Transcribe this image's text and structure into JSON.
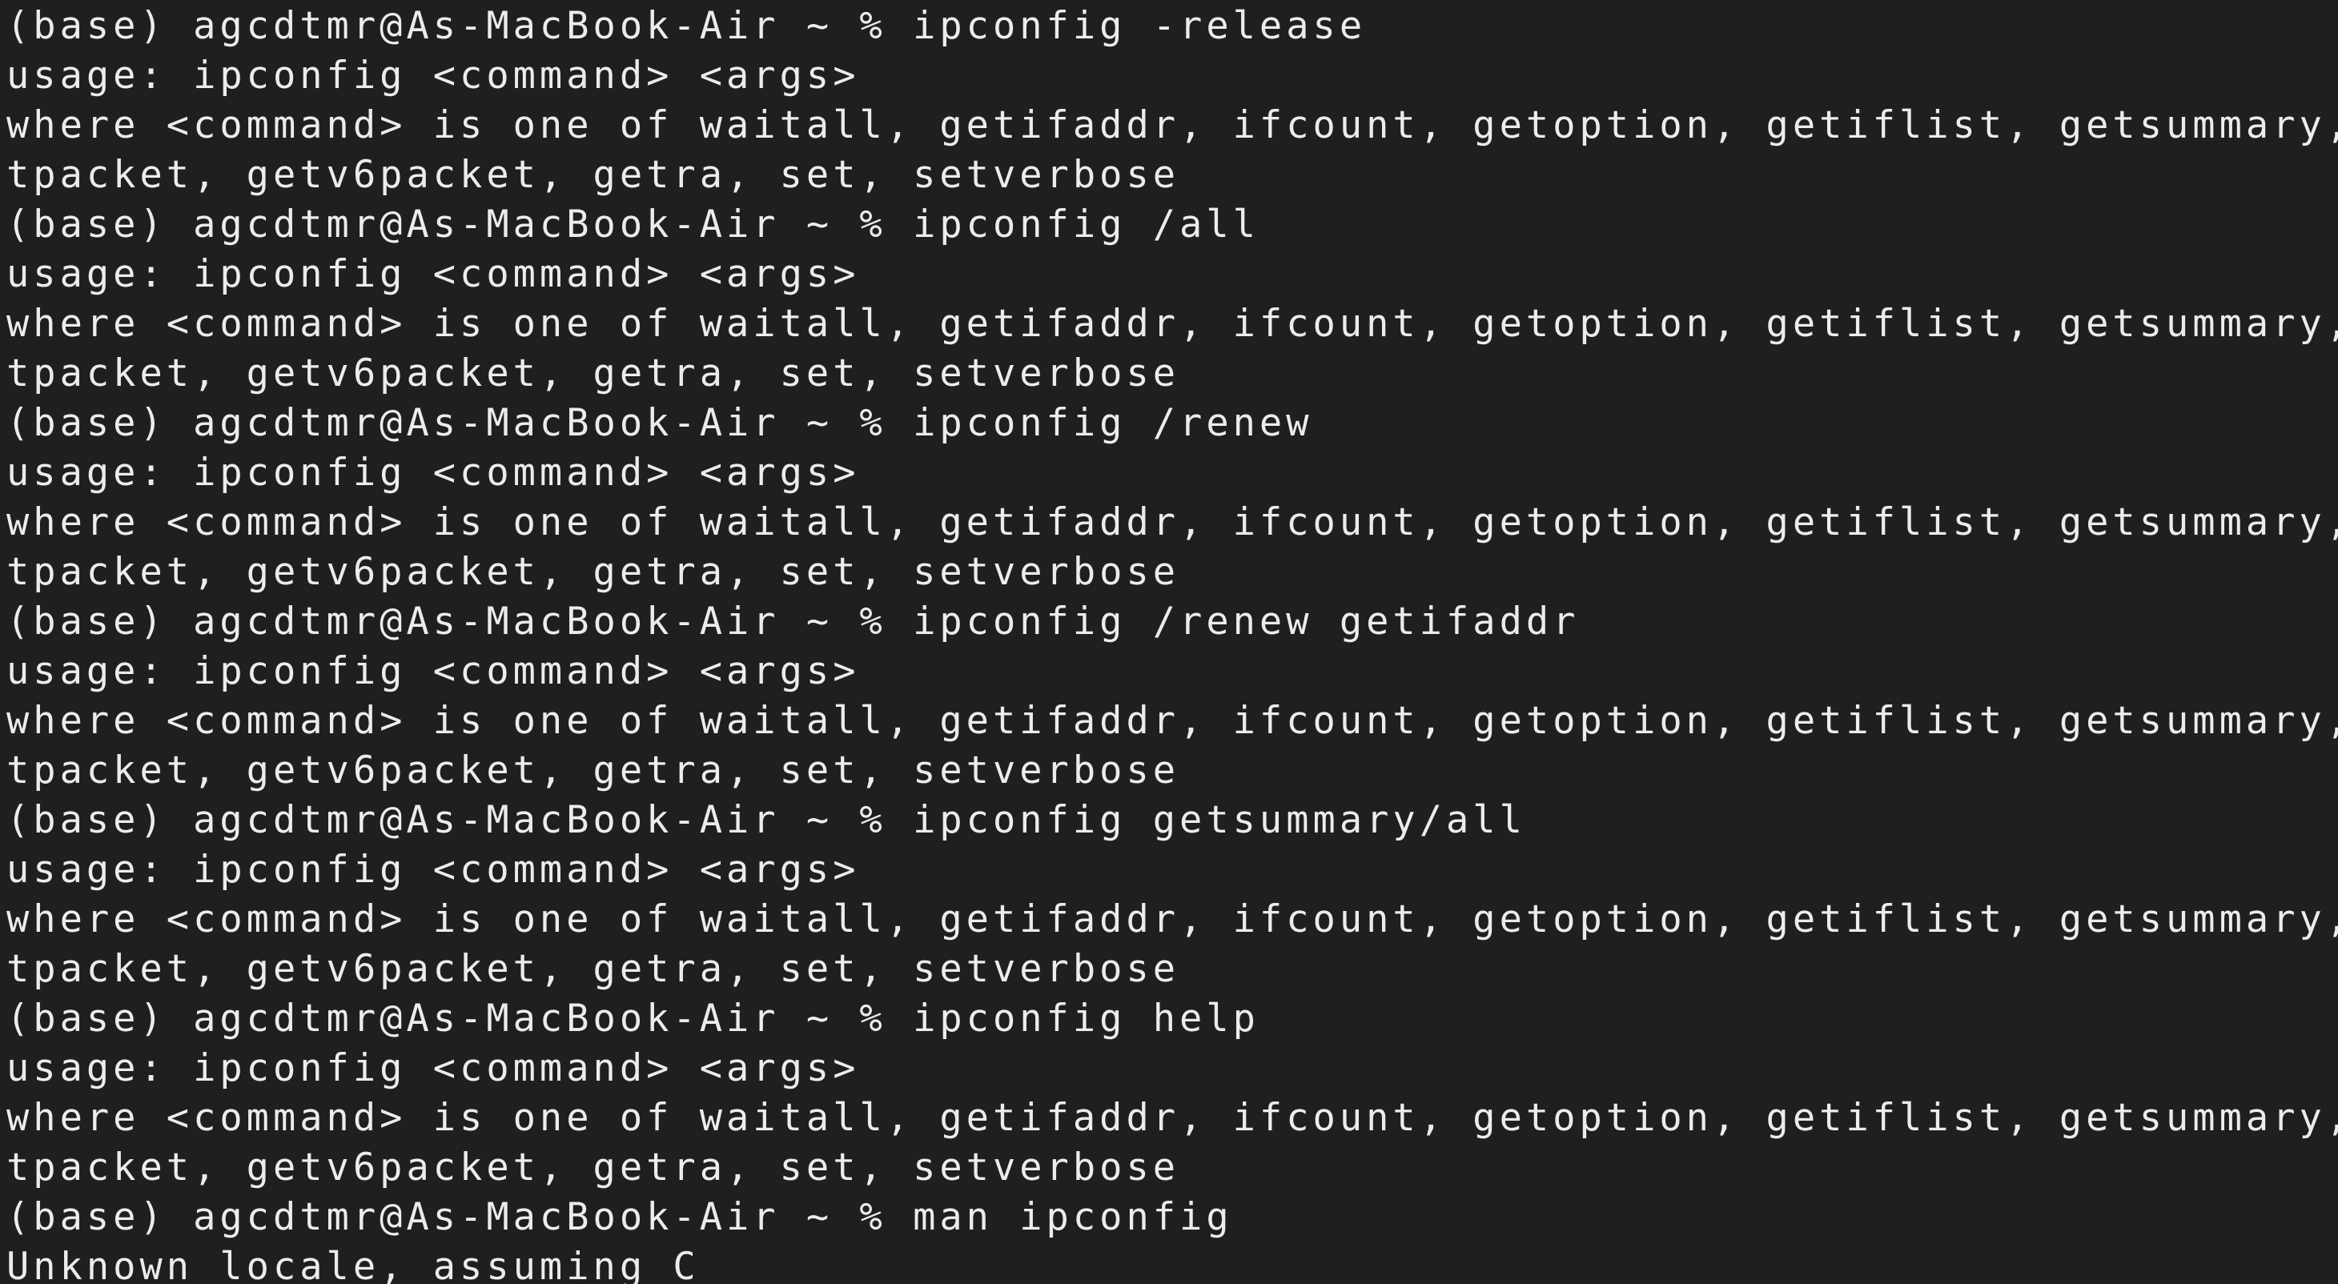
{
  "terminal": {
    "lines": [
      {
        "type": "prompt",
        "prompt": "(base) agcdtmr@As-MacBook-Air ~ % ",
        "command": "ipconfig -release"
      },
      {
        "type": "output",
        "text": "usage: ipconfig <command> <args>"
      },
      {
        "type": "output",
        "text": "where <command> is one of waitall, getifaddr, ifcount, getoption, getiflist, getsummary, ge"
      },
      {
        "type": "output",
        "text": "tpacket, getv6packet, getra, set, setverbose"
      },
      {
        "type": "prompt",
        "prompt": "(base) agcdtmr@As-MacBook-Air ~ % ",
        "command": "ipconfig /all"
      },
      {
        "type": "output",
        "text": "usage: ipconfig <command> <args>"
      },
      {
        "type": "output",
        "text": "where <command> is one of waitall, getifaddr, ifcount, getoption, getiflist, getsummary, ge"
      },
      {
        "type": "output",
        "text": "tpacket, getv6packet, getra, set, setverbose"
      },
      {
        "type": "prompt",
        "prompt": "(base) agcdtmr@As-MacBook-Air ~ % ",
        "command": "ipconfig /renew"
      },
      {
        "type": "output",
        "text": "usage: ipconfig <command> <args>"
      },
      {
        "type": "output",
        "text": "where <command> is one of waitall, getifaddr, ifcount, getoption, getiflist, getsummary, ge"
      },
      {
        "type": "output",
        "text": "tpacket, getv6packet, getra, set, setverbose"
      },
      {
        "type": "prompt",
        "prompt": "(base) agcdtmr@As-MacBook-Air ~ % ",
        "command": "ipconfig /renew getifaddr"
      },
      {
        "type": "output",
        "text": "usage: ipconfig <command> <args>"
      },
      {
        "type": "output",
        "text": "where <command> is one of waitall, getifaddr, ifcount, getoption, getiflist, getsummary, ge"
      },
      {
        "type": "output",
        "text": "tpacket, getv6packet, getra, set, setverbose"
      },
      {
        "type": "prompt",
        "prompt": "(base) agcdtmr@As-MacBook-Air ~ % ",
        "command": "ipconfig getsummary/all"
      },
      {
        "type": "output",
        "text": "usage: ipconfig <command> <args>"
      },
      {
        "type": "output",
        "text": "where <command> is one of waitall, getifaddr, ifcount, getoption, getiflist, getsummary, ge"
      },
      {
        "type": "output",
        "text": "tpacket, getv6packet, getra, set, setverbose"
      },
      {
        "type": "prompt",
        "prompt": "(base) agcdtmr@As-MacBook-Air ~ % ",
        "command": "ipconfig help"
      },
      {
        "type": "output",
        "text": "usage: ipconfig <command> <args>"
      },
      {
        "type": "output",
        "text": "where <command> is one of waitall, getifaddr, ifcount, getoption, getiflist, getsummary, ge"
      },
      {
        "type": "output",
        "text": "tpacket, getv6packet, getra, set, setverbose"
      },
      {
        "type": "prompt",
        "prompt": "(base) agcdtmr@As-MacBook-Air ~ % ",
        "command": "man ipconfig"
      },
      {
        "type": "output",
        "text": "Unknown locale, assuming C"
      }
    ]
  },
  "colors": {
    "background": "#1f1f1f",
    "text": "#ececec",
    "marker": "#9a9a9a"
  }
}
